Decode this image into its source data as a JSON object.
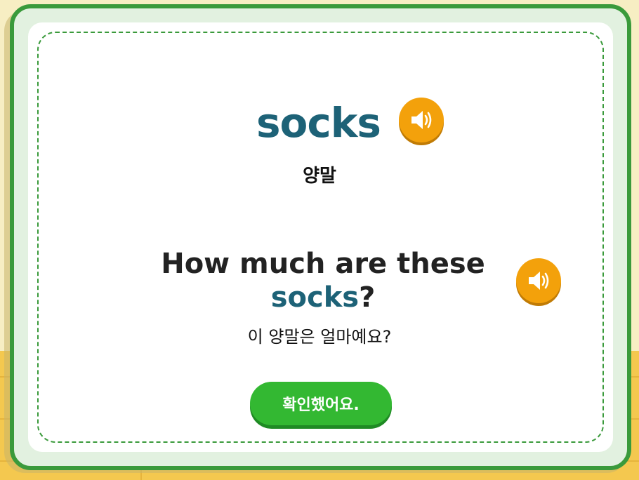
{
  "flashcard": {
    "word": "socks",
    "word_meaning": "양말",
    "sentence_before": "How much are these",
    "sentence_highlight": "socks",
    "sentence_after": "?",
    "translation": "이 양말은 얼마예요?",
    "confirm_label": "확인했어요."
  },
  "icons": {
    "word_audio": "speaker-icon",
    "sentence_audio": "speaker-icon"
  },
  "colors": {
    "frame_green": "#3a9a3b",
    "word_teal": "#1d6277",
    "audio_orange": "#f3a10b",
    "button_green": "#33b832"
  }
}
